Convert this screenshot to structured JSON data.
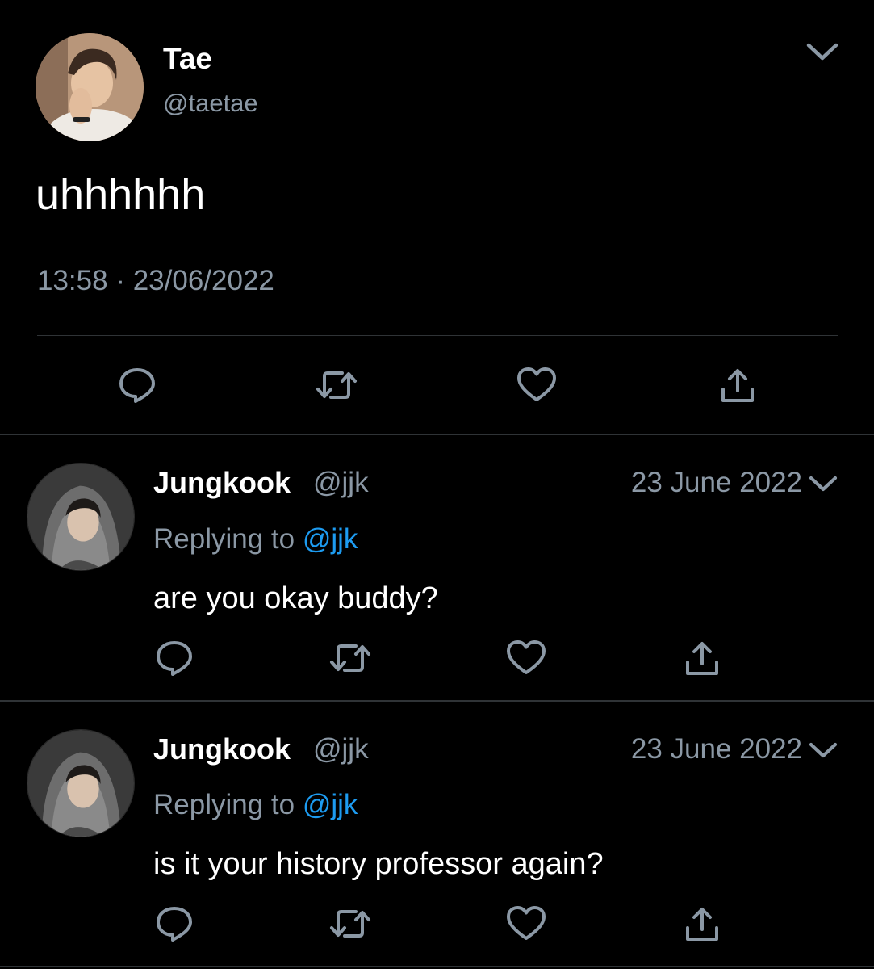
{
  "main_tweet": {
    "name": "Tae",
    "handle": "@taetae",
    "text": "uhhhhhh",
    "time": "13:58",
    "separator": "·",
    "date": "23/06/2022",
    "avatar_icon": "user-avatar-photo",
    "menu_icon": "chevron-down-icon",
    "actions": [
      "reply-icon",
      "retweet-icon",
      "like-icon",
      "share-icon"
    ]
  },
  "replies": [
    {
      "name": "Jungkook",
      "handle": "@jjk",
      "date": "23 June 2022",
      "replying_prefix": "Replying to",
      "replying_to": "@jjk",
      "text": "are you okay buddy?",
      "avatar_icon": "user-avatar-photo",
      "menu_icon": "chevron-down-icon"
    },
    {
      "name": "Jungkook",
      "handle": "@jjk",
      "date": "23 June 2022",
      "replying_prefix": "Replying to",
      "replying_to": "@jjk",
      "text": "is it your history professor again?",
      "avatar_icon": "user-avatar-photo",
      "menu_icon": "chevron-down-icon"
    }
  ],
  "colors": {
    "background": "#000000",
    "primary_text": "#ffffff",
    "secondary_text": "#8b98a5",
    "mention": "#1d9bf0",
    "divider": "#2f3336"
  }
}
